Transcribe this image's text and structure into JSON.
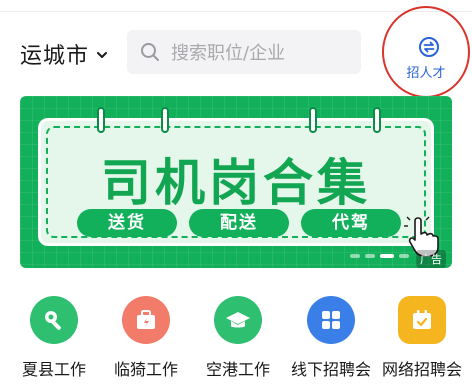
{
  "header": {
    "city": "运城市",
    "search_placeholder": "搜索职位/企业",
    "recruit_label": "招人才"
  },
  "banner": {
    "title": "司机岗合集",
    "tags": [
      "送货",
      "配送",
      "代驾"
    ],
    "ad_label": "广告",
    "slide_count": 4,
    "active_slide": 2
  },
  "shortcuts": [
    {
      "label": "夏县工作",
      "icon": "wrench-icon",
      "color": "#2fbf71"
    },
    {
      "label": "临猗工作",
      "icon": "briefcase-icon",
      "color": "#f27b6a"
    },
    {
      "label": "空港工作",
      "icon": "graduation-cap-icon",
      "color": "#2fbf71"
    },
    {
      "label": "线下招聘会",
      "icon": "grid-icon",
      "color": "#3a7fe8"
    },
    {
      "label": "网络招聘会",
      "icon": "calendar-icon",
      "color": "#f5b51f"
    }
  ]
}
